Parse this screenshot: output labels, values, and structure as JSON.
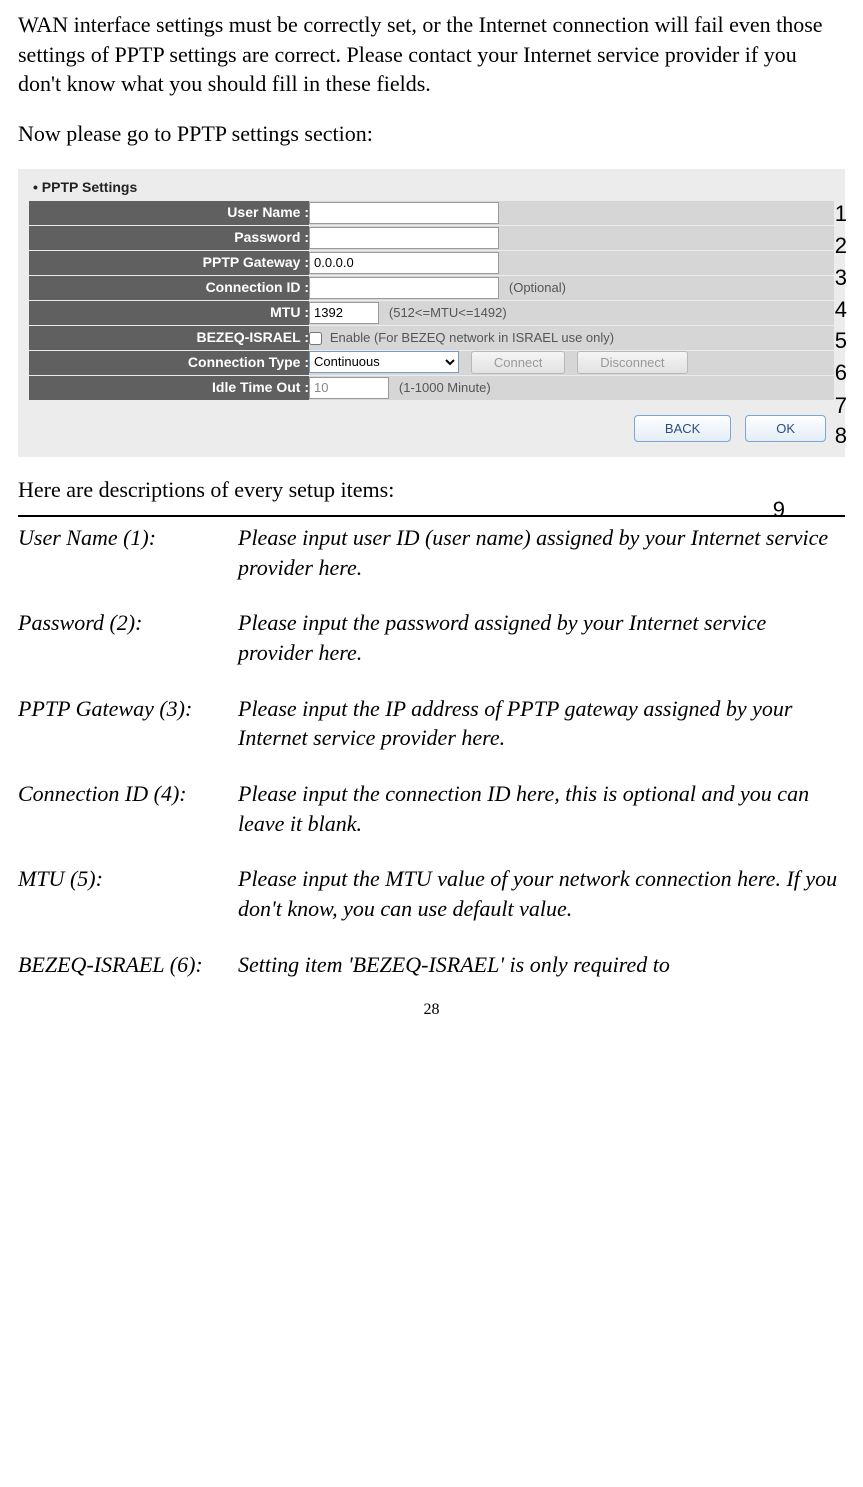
{
  "intro": {
    "para1": "WAN interface settings must be correctly set, or the Internet connection will fail even those settings of PPTP settings are correct. Please contact your Internet service provider if you don't know what you should fill in these fields.",
    "para2": "Now please go to PPTP settings section:"
  },
  "panel": {
    "title": "PPTP Settings",
    "rows": {
      "username_label": "User Name :",
      "username_value": "",
      "password_label": "Password :",
      "password_value": "",
      "gateway_label": "PPTP Gateway :",
      "gateway_value": "0.0.0.0",
      "connid_label": "Connection ID :",
      "connid_value": "",
      "connid_hint": "(Optional)",
      "mtu_label": "MTU :",
      "mtu_value": "1392",
      "mtu_hint": "(512<=MTU<=1492)",
      "bezeq_label": "BEZEQ-ISRAEL :",
      "bezeq_text": "Enable (For BEZEQ network in ISRAEL use only)",
      "conntype_label": "Connection Type :",
      "conntype_value": "Continuous",
      "connect_btn": "Connect",
      "disconnect_btn": "Disconnect",
      "idle_label": "Idle Time Out :",
      "idle_value": "10",
      "idle_hint": "(1-1000 Minute)"
    },
    "back_btn": "BACK",
    "ok_btn": "OK"
  },
  "callouts": {
    "n1": "1",
    "n2": "2",
    "n3": "3",
    "n4": "4",
    "n5": "5",
    "n6": "6",
    "n7": "7",
    "n8": "8",
    "n9": "9"
  },
  "desc": {
    "heading": "Here are descriptions of every setup items:",
    "items": [
      {
        "term": "User Name (1):",
        "def": "Please input user ID (user name) assigned by your Internet service provider here."
      },
      {
        "term": "Password (2):",
        "def": "Please input the password assigned by your Internet service provider here."
      },
      {
        "term": "PPTP Gateway (3):",
        "def": "Please input the IP address of PPTP gateway assigned by your Internet service provider here."
      },
      {
        "term": "Connection ID (4):",
        "def": "Please input the connection ID here, this is optional and you can leave it blank."
      },
      {
        "term": "MTU (5):",
        "def": "Please input the MTU value of your network connection here. If you don't know, you can use default value."
      },
      {
        "term": "BEZEQ-ISRAEL (6):",
        "def": "Setting item 'BEZEQ-ISRAEL' is only required to"
      }
    ]
  },
  "page_number": "28"
}
